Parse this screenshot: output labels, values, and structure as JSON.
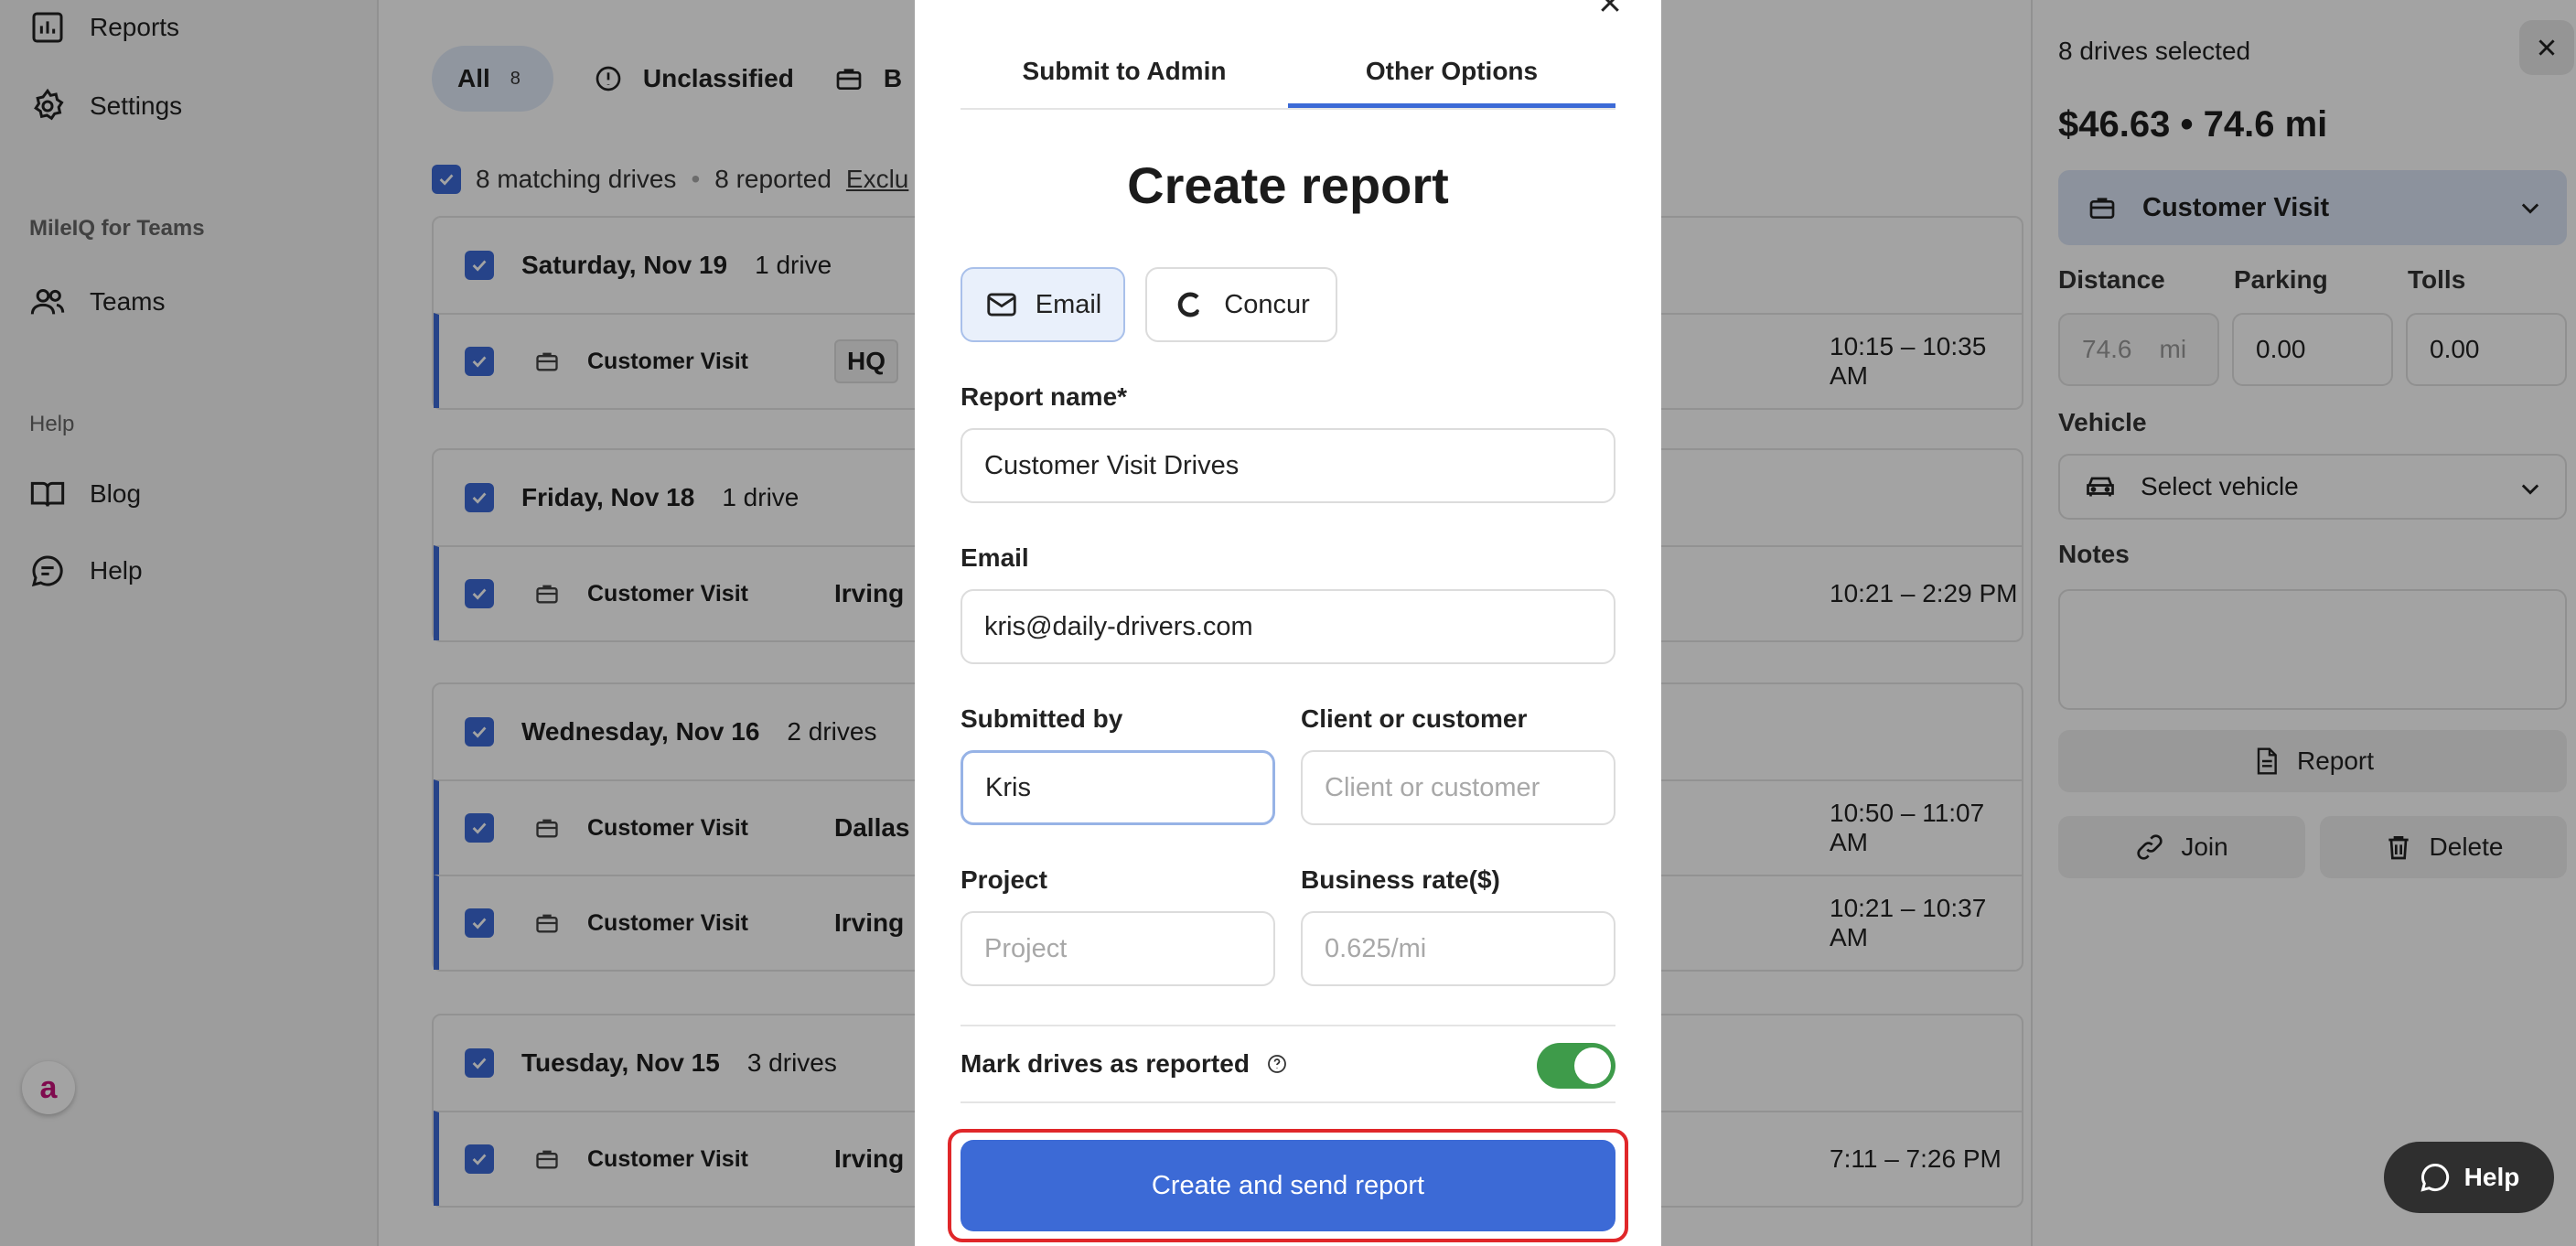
{
  "sidebar": {
    "reports_label": "Reports",
    "settings_label": "Settings",
    "teams_section": "MileIQ for Teams",
    "teams_label": "Teams",
    "help_section": "Help",
    "blog_label": "Blog",
    "help_label": "Help",
    "assist_glyph": "a"
  },
  "filters": {
    "all_label": "All",
    "all_count": "8",
    "unclassified_label": "Unclassified",
    "business_label": "B"
  },
  "list": {
    "matching": "8 matching drives",
    "separator": "•",
    "reported": "8 reported",
    "exclude_link": "Exclu",
    "groups": [
      {
        "date": "Saturday, Nov 19",
        "count": "1 drive",
        "drives": [
          {
            "category": "Customer Visit",
            "place": "HQ",
            "time": "10:15 – 10:35 AM"
          }
        ]
      },
      {
        "date": "Friday, Nov 18",
        "count": "1 drive",
        "drives": [
          {
            "category": "Customer Visit",
            "place": "Irving",
            "time": "10:21 – 2:29 PM"
          }
        ]
      },
      {
        "date": "Wednesday, Nov 16",
        "count": "2 drives",
        "drives": [
          {
            "category": "Customer Visit",
            "place": "Dallas",
            "time": "10:50 – 11:07 AM"
          },
          {
            "category": "Customer Visit",
            "place": "Irving",
            "time": "10:21 – 10:37 AM"
          }
        ]
      },
      {
        "date": "Tuesday, Nov 15",
        "count": "3 drives",
        "drives": [
          {
            "category": "Customer Visit",
            "place": "Irving",
            "time": "7:11 – 7:26 PM"
          }
        ]
      }
    ]
  },
  "panel": {
    "selected": "8 drives selected",
    "amount": "$46.63",
    "dot": "•",
    "distance_total": "74.6 mi",
    "category": "Customer Visit",
    "distance_label": "Distance",
    "distance_value": "74.6",
    "distance_unit": "mi",
    "parking_label": "Parking",
    "parking_value": "0.00",
    "tolls_label": "Tolls",
    "tolls_value": "0.00",
    "vehicle_label": "Vehicle",
    "vehicle_value": "Select vehicle",
    "notes_label": "Notes",
    "report_button": "Report",
    "join_button": "Join",
    "delete_button": "Delete",
    "help_button": "Help"
  },
  "modal": {
    "tab_submit": "Submit to Admin",
    "tab_other": "Other Options",
    "title": "Create report",
    "method_email": "Email",
    "method_concur": "Concur",
    "report_name_label": "Report name*",
    "report_name_value": "Customer Visit Drives",
    "email_label": "Email",
    "email_value": "kris@daily-drivers.com",
    "submitted_by_label": "Submitted by",
    "submitted_by_value": "Kris",
    "client_label": "Client or customer",
    "client_placeholder": "Client or customer",
    "project_label": "Project",
    "project_placeholder": "Project",
    "rate_label": "Business rate($)",
    "rate_placeholder": "0.625/mi",
    "mark_reported_label": "Mark drives as reported",
    "mark_reported_on": true,
    "submit_label": "Create and send report"
  },
  "colors": {
    "accent": "#3c6ad6",
    "toggle_on": "#3e9b4a",
    "highlight": "#e0272a"
  }
}
